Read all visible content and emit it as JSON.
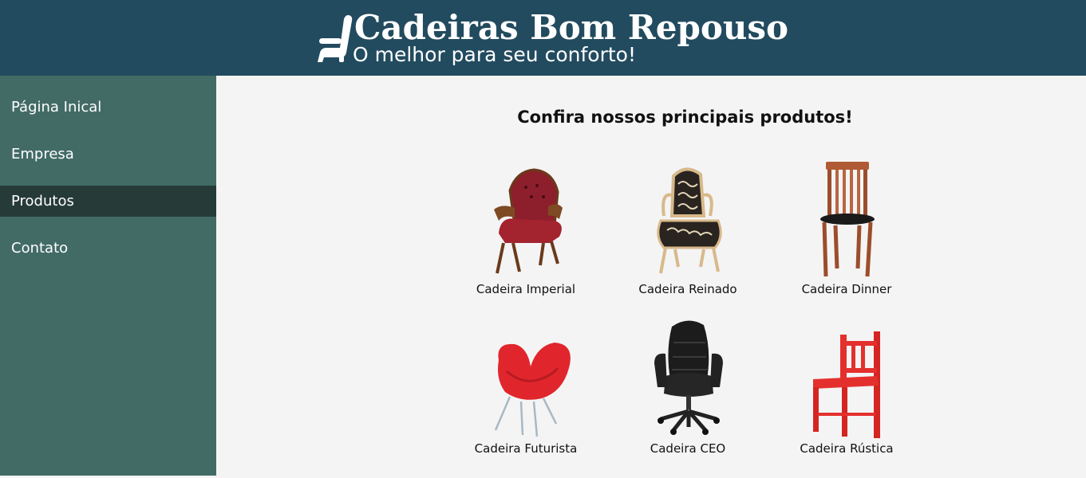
{
  "header": {
    "title": "Cadeiras Bom Repouso",
    "subtitle": "O melhor para seu conforto!",
    "logo_icon": "chair-icon"
  },
  "nav": {
    "items": [
      {
        "label": "Página Inical",
        "active": false
      },
      {
        "label": "Empresa",
        "active": false
      },
      {
        "label": "Produtos",
        "active": true
      },
      {
        "label": "Contato",
        "active": false
      }
    ]
  },
  "main": {
    "heading": "Confira nossos principais produtos!",
    "products": [
      {
        "name": "Cadeira Imperial",
        "image": "red-velvet-armchair"
      },
      {
        "name": "Cadeira Reinado",
        "image": "baroque-patterned-armchair"
      },
      {
        "name": "Cadeira Dinner",
        "image": "wooden-dining-chair"
      },
      {
        "name": "Cadeira Futurista",
        "image": "red-futuristic-chair"
      },
      {
        "name": "Cadeira CEO",
        "image": "black-office-chair"
      },
      {
        "name": "Cadeira Rústica",
        "image": "red-rustic-chair"
      }
    ]
  },
  "colors": {
    "header_bg": "#224b5f",
    "sidebar_bg": "#426b66",
    "sidebar_active_bg": "#263b38",
    "content_bg": "#f4f4f4"
  }
}
